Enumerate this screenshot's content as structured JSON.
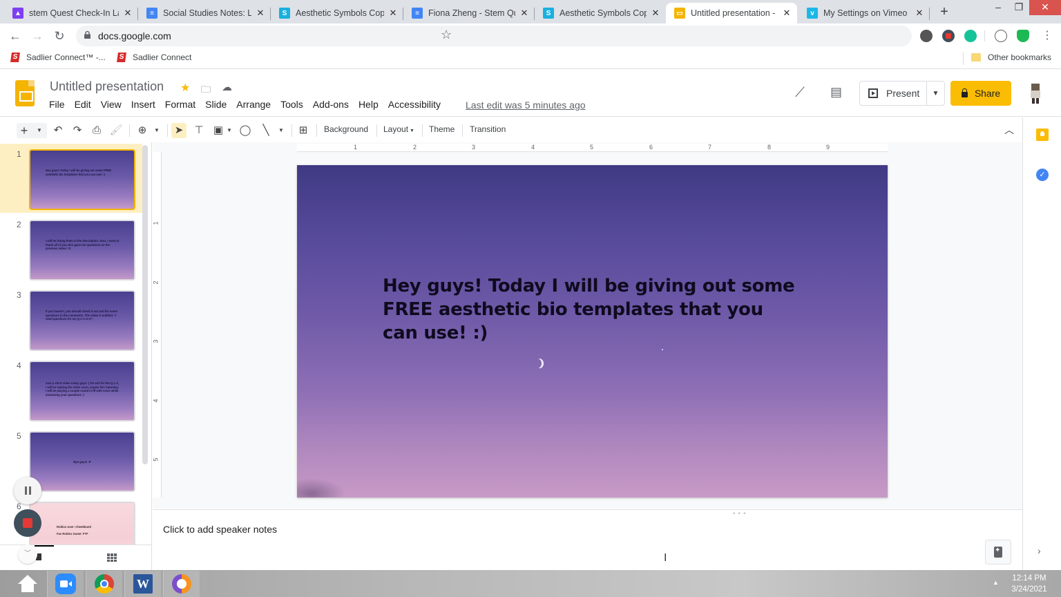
{
  "browser": {
    "tabs": [
      {
        "title": "stem Quest Check-In La",
        "favicon": "classroom-icon",
        "color": "#7e3ff2",
        "active": false
      },
      {
        "title": "Social Studies Notes: Le",
        "favicon": "docs-icon",
        "color": "#4285f4",
        "active": false
      },
      {
        "title": "Aesthetic Symbols Copy",
        "favicon": "symbols-icon",
        "color": "#1ab0e0",
        "active": false
      },
      {
        "title": "Fiona Zheng - Stem Qu",
        "favicon": "docs-icon",
        "color": "#4285f4",
        "active": false
      },
      {
        "title": "Aesthetic Symbols Copy",
        "favicon": "symbols-icon",
        "color": "#1ab0e0",
        "active": false
      },
      {
        "title": "Untitled presentation - ",
        "favicon": "slides-icon",
        "color": "#f4b400",
        "active": true
      },
      {
        "title": "My Settings on Vimeo",
        "favicon": "vimeo-icon",
        "color": "#1ab7ea",
        "active": false
      }
    ],
    "url": "docs.google.com",
    "bookmarks": [
      {
        "label": "Sadlier Connect™ -..."
      },
      {
        "label": "Sadlier Connect"
      }
    ],
    "other_bookmarks": "Other bookmarks"
  },
  "app": {
    "title": "Untitled presentation",
    "menu": [
      "File",
      "Edit",
      "View",
      "Insert",
      "Format",
      "Slide",
      "Arrange",
      "Tools",
      "Add-ons",
      "Help",
      "Accessibility"
    ],
    "last_edit": "Last edit was 5 minutes ago",
    "present_label": "Present",
    "share_label": "Share",
    "brand_color": "#fbbc04"
  },
  "toolbar": {
    "background": "Background",
    "layout": "Layout",
    "theme": "Theme",
    "transition": "Transition"
  },
  "ruler": {
    "horizontal": [
      "1",
      "2",
      "3",
      "4",
      "5",
      "6",
      "7",
      "8",
      "9"
    ],
    "vertical": [
      "1",
      "2",
      "3",
      "4",
      "5"
    ]
  },
  "slides": [
    {
      "number": "1",
      "text": "Hey guys! Today I will be giving out some FREE aesthetic bio templates that you can use! :)",
      "selected": true
    },
    {
      "number": "2",
      "text": "I will be listing them in the description. Also, I want to thank all of you who gave me questions on the previous video! :D",
      "selected": false
    },
    {
      "number": "3",
      "text": "If you haven't, you should check it out and list some questions in the comments. The video is entitled, \"I need questions for my Q n A O-O\".",
      "selected": false
    },
    {
      "number": "4",
      "text": "Just a short video today guys :( Oh and for the Q n A, I will be making the video soon, maybe this Saturday. I will be playing a couple round in ftf with voice while answering your questions :)",
      "selected": false
    },
    {
      "number": "5",
      "text": "Bye guys! :P",
      "selected": false
    },
    {
      "number": "6",
      "text": "Roblox User: Cheekbunti\nFav Roblox Game: FTF",
      "selected": false
    }
  ],
  "current_slide": {
    "text": "Hey guys! Today I will be giving out some FREE aesthetic bio templates that you can use! :)"
  },
  "notes": {
    "placeholder": "Click to add speaker notes"
  },
  "taskbar": {
    "apps": [
      "home-icon",
      "zoom-icon",
      "chrome-icon",
      "word-icon",
      "vpn-icon"
    ],
    "time": "12:14 PM",
    "date": "3/24/2021"
  }
}
